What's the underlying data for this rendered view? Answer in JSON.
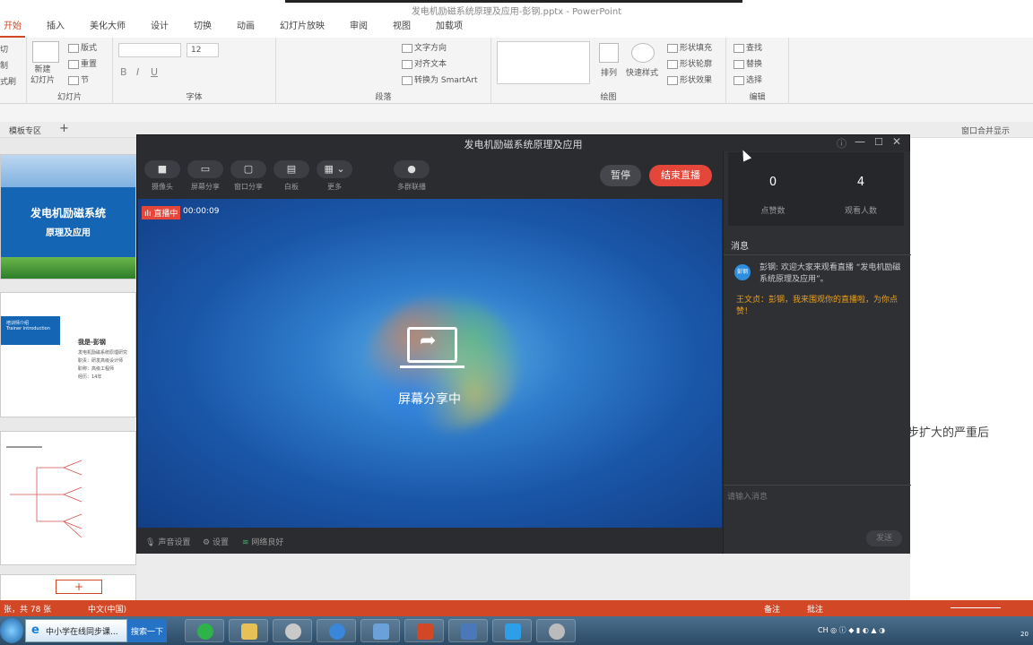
{
  "app": {
    "doc_title": "发电机励磁系统原理及应用-彭钢.pptx - PowerPoint"
  },
  "ribbon_tabs": [
    "开始",
    "插入",
    "美化大师",
    "设计",
    "切换",
    "动画",
    "幻灯片放映",
    "审阅",
    "视图",
    "加载项"
  ],
  "ribbon": {
    "clipboard": {
      "cut": "切",
      "copy": "制",
      "format": "式刷"
    },
    "slides": {
      "new_slide": "新建\n幻灯片",
      "layout": "版式",
      "reset": "重置",
      "section": "节",
      "label": "幻灯片"
    },
    "font": {
      "label": "字体",
      "size": "12"
    },
    "paragraph": {
      "text_direction": "文字方向",
      "align_text": "对齐文本",
      "smartart": "转换为 SmartArt",
      "label": "段落"
    },
    "drawing": {
      "arrange": "排列",
      "quick_styles": "快速样式",
      "shape_fill": "形状填充",
      "shape_outline": "形状轮廓",
      "shape_effects": "形状效果",
      "label": "绘图"
    },
    "editing": {
      "find": "查找",
      "replace": "替换",
      "select": "选择",
      "label": "编辑"
    }
  },
  "tabbar": {
    "template_tab": "模板专区",
    "add_tab": "+",
    "window_merge": "窗口合并显示"
  },
  "slides": {
    "slide1_title": "发电机励磁系统",
    "slide1_subtitle": "原理及应用",
    "slide2_box_title": "培训师介绍",
    "slide2_box_sub": "Trainer introduction",
    "slide2_name": "我是-彭钢",
    "slide2_lines": [
      "发电机励磁系统原理研究",
      "职责：研发高级设计师",
      "职称：高级工程师",
      "经历：14年"
    ],
    "add_slide": "+"
  },
  "document_text": "步扩大的严重后",
  "status": {
    "slide_count": "张，共 78 张",
    "language": "中文(中国)",
    "notes": "备注",
    "comments": "批注"
  },
  "taskbar": {
    "ie_window": "中小学在线同步课...",
    "search": "搜索一下"
  },
  "live": {
    "title": "发电机励磁系统原理及应用",
    "tools": [
      {
        "label": "摄像头",
        "icon": "camera-icon"
      },
      {
        "label": "屏幕分享",
        "icon": "screen-share-icon"
      },
      {
        "label": "窗口分享",
        "icon": "window-share-icon"
      },
      {
        "label": "白板",
        "icon": "whiteboard-icon"
      },
      {
        "label": "更多",
        "icon": "more-grid-icon"
      },
      {
        "label": "多群联播",
        "icon": "multi-group-icon"
      }
    ],
    "pause": "暂停",
    "end": "结束直播",
    "badge": "直播中",
    "time": "00:00:09",
    "sharing": "屏幕分享中",
    "bottom": {
      "audio": "声音设置",
      "settings": "设置",
      "network": "网络良好"
    },
    "stats": {
      "likes": "0",
      "likes_label": "点赞数",
      "viewers": "4",
      "viewers_label": "观看人数"
    },
    "messages_head": "消息",
    "avatar_text": "彭钢",
    "msg1": "彭钢: 欢迎大家来观看直播 “发电机励磁系统原理及应用”。",
    "msg2": "王文贞：彭钢，我来围观你的直播啦，为你点赞！",
    "input_placeholder": "请输入消息",
    "send": "发送"
  }
}
